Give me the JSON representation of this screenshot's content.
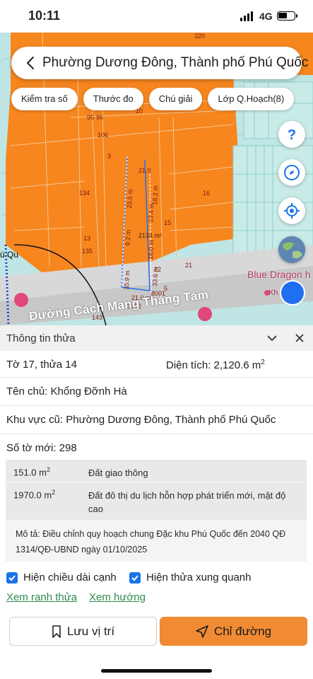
{
  "status": {
    "time": "10:11",
    "network": "4G"
  },
  "header": {
    "title": "Phường Dương Đông, Thành phố Phú Quốc"
  },
  "chips": [
    "Kiểm tra số",
    "Thước đo",
    "Chú giải",
    "Lớp Q.Hoạch(8)"
  ],
  "map": {
    "street": "Đường Cách Mạng Tháng Tám",
    "poi": "Blue Dragon h",
    "poi_secondary": "Kh",
    "area_label": "2134 m²",
    "district_fragment": "ú Qu",
    "parcel_labels": [
      "320",
      "106",
      "3",
      "134",
      "16",
      "13",
      "135",
      "15",
      "22",
      "21",
      "5",
      "3002",
      "10",
      "95",
      "96",
      "8001",
      "143"
    ],
    "edge_labels": [
      "21.0",
      "23.5 m",
      "18.2 m",
      "9.2 m",
      "16.0 m",
      "33.6 m",
      "35.9 m",
      "21.0 m",
      "13.4 m"
    ]
  },
  "panel": {
    "title": "Thông tin thửa",
    "sheet_parcel": "Tờ 17, thửa 14",
    "area_label": "Diện tích: 2,120.6 m",
    "area_sup": "2",
    "owner": "Tên chủ: Khổng Đỡnh Hà",
    "old_region": "Khu vực cũ: Phường Dương Đông, Thành phố Phú Quốc",
    "new_sheet": "Số tờ mới: 298",
    "zones": [
      {
        "area": "151.0 m",
        "sup": "2",
        "desc": "Đất giao thông"
      },
      {
        "area": "1970.0 m",
        "sup": "2",
        "desc": "Đất đô thị du lịch hỗn hợp phát triển mới, mật độ cao"
      }
    ],
    "zone_description": "Mô tả: Điều chỉnh quy hoạch chung Đặc khu Phú Quốc đến 2040 QĐ 1314/QĐ-UBND ngày 01/10/2025",
    "check_edge": "Hiện chiều dài cạnh",
    "check_neighbors": "Hiện thửa xung quanh",
    "link_boundary": "Xem ranh thửa",
    "link_direction": "Xem hướng",
    "btn_save": "Lưu vị trí",
    "btn_directions": "Chỉ đường"
  },
  "colors": {
    "parcel_fill": "#f7861f",
    "accent": "#1a73e8",
    "primary_button": "#f08b34",
    "link": "#2e8b4f"
  }
}
